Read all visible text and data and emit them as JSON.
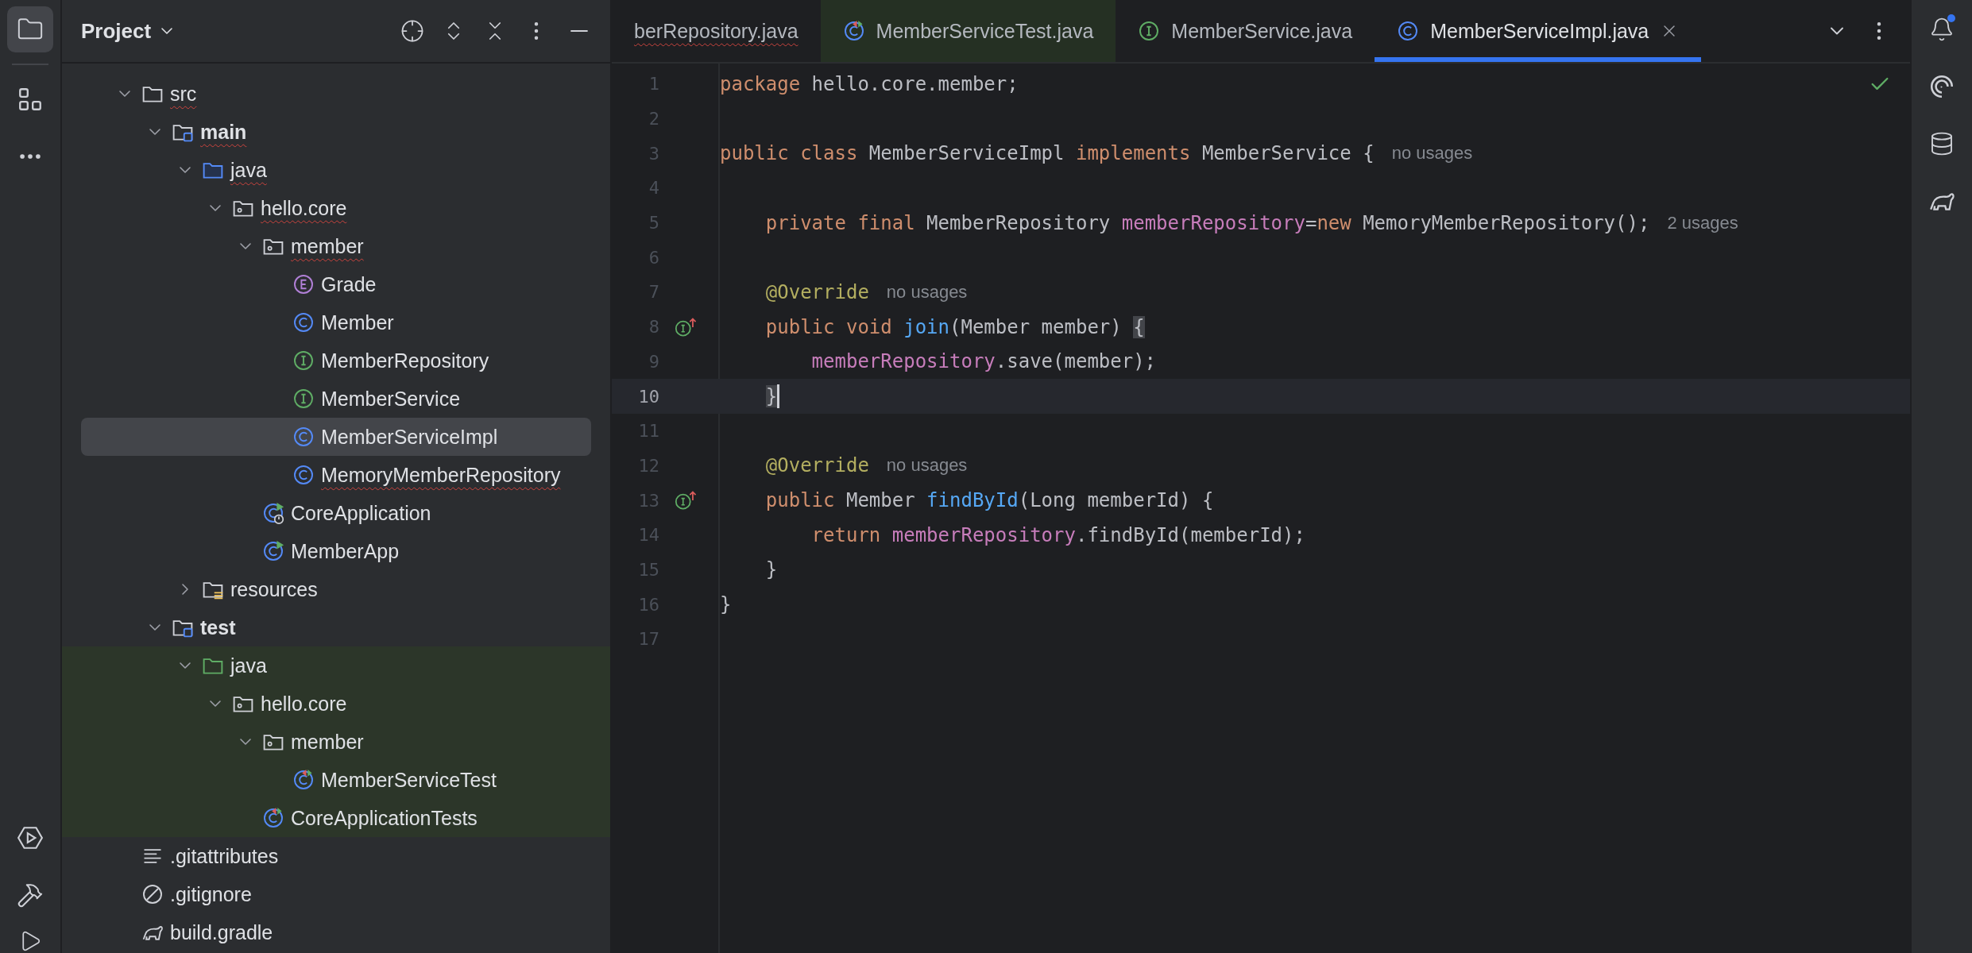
{
  "project_panel": {
    "title": "Project",
    "tree": [
      {
        "label": "src",
        "kind": "folder",
        "expanded": true,
        "selected": false,
        "error": true,
        "tinted": false,
        "children": [
          {
            "label": "main",
            "kind": "source-root",
            "expanded": true,
            "selected": false,
            "error": true,
            "tinted": false,
            "children": [
              {
                "label": "java",
                "kind": "source-folder",
                "expanded": true,
                "selected": false,
                "error": true,
                "tinted": false,
                "children": [
                  {
                    "label": "hello.core",
                    "kind": "package",
                    "expanded": true,
                    "selected": false,
                    "error": true,
                    "tinted": false,
                    "children": [
                      {
                        "label": "member",
                        "kind": "package",
                        "expanded": true,
                        "selected": false,
                        "error": true,
                        "tinted": false,
                        "children": [
                          {
                            "label": "Grade",
                            "kind": "enum",
                            "selected": false,
                            "error": false,
                            "tinted": false
                          },
                          {
                            "label": "Member",
                            "kind": "class",
                            "selected": false,
                            "error": false,
                            "tinted": false
                          },
                          {
                            "label": "MemberRepository",
                            "kind": "interface",
                            "selected": false,
                            "error": false,
                            "tinted": false
                          },
                          {
                            "label": "MemberService",
                            "kind": "interface",
                            "selected": false,
                            "error": false,
                            "tinted": false
                          },
                          {
                            "label": "MemberServiceImpl",
                            "kind": "class",
                            "selected": true,
                            "error": false,
                            "tinted": false
                          },
                          {
                            "label": "MemoryMemberRepository",
                            "kind": "class",
                            "selected": false,
                            "error": true,
                            "tinted": false
                          }
                        ]
                      },
                      {
                        "label": "CoreApplication",
                        "kind": "spring-app",
                        "selected": false,
                        "error": false,
                        "tinted": false
                      },
                      {
                        "label": "MemberApp",
                        "kind": "runnable",
                        "selected": false,
                        "error": false,
                        "tinted": false
                      }
                    ]
                  }
                ]
              },
              {
                "label": "resources",
                "kind": "resources",
                "expanded": false,
                "selected": false,
                "error": false,
                "tinted": false
              }
            ]
          },
          {
            "label": "test",
            "kind": "source-root",
            "expanded": true,
            "selected": false,
            "error": false,
            "tinted": false,
            "children": [
              {
                "label": "java",
                "kind": "test-folder",
                "expanded": true,
                "selected": false,
                "error": false,
                "tinted": true,
                "children": [
                  {
                    "label": "hello.core",
                    "kind": "package",
                    "expanded": true,
                    "selected": false,
                    "error": false,
                    "tinted": true,
                    "children": [
                      {
                        "label": "member",
                        "kind": "package",
                        "expanded": true,
                        "selected": false,
                        "error": false,
                        "tinted": true,
                        "children": [
                          {
                            "label": "MemberServiceTest",
                            "kind": "test-class",
                            "selected": false,
                            "error": false,
                            "tinted": true
                          }
                        ]
                      },
                      {
                        "label": "CoreApplicationTests",
                        "kind": "test-class",
                        "selected": false,
                        "error": false,
                        "tinted": true
                      }
                    ]
                  }
                ]
              }
            ]
          }
        ]
      },
      {
        "label": ".gitattributes",
        "kind": "text-file",
        "selected": false,
        "error": false,
        "tinted": false
      },
      {
        "label": ".gitignore",
        "kind": "ignore-file",
        "selected": false,
        "error": false,
        "tinted": false
      },
      {
        "label": "build.gradle",
        "kind": "gradle",
        "selected": false,
        "error": false,
        "tinted": false
      }
    ]
  },
  "editor": {
    "tabs": [
      {
        "label": "berRepository.java",
        "kind": "cut-off",
        "selected": false,
        "tinted": false,
        "error": true
      },
      {
        "label": "MemberServiceTest.java",
        "kind": "test-class",
        "selected": false,
        "tinted": true,
        "error": false
      },
      {
        "label": "MemberService.java",
        "kind": "interface",
        "selected": false,
        "tinted": false,
        "error": false
      },
      {
        "label": "MemberServiceImpl.java",
        "kind": "class",
        "selected": true,
        "tinted": false,
        "error": false
      }
    ],
    "lines": [
      {
        "number": "1",
        "current": false,
        "marker": false,
        "tokens": [
          {
            "kind": "keyword",
            "text": "package"
          },
          {
            "kind": "plain",
            "text": " hello.core.member;"
          }
        ]
      },
      {
        "number": "2",
        "current": false,
        "marker": false
      },
      {
        "number": "3",
        "current": false,
        "marker": false,
        "tokens": [
          {
            "kind": "keyword",
            "text": "public class "
          },
          {
            "kind": "plain",
            "text": "MemberServiceImpl "
          },
          {
            "kind": "keyword",
            "text": "implements "
          },
          {
            "kind": "plain",
            "text": "MemberService {"
          }
        ],
        "hint": "no usages"
      },
      {
        "number": "4",
        "current": false,
        "marker": false
      },
      {
        "number": "5",
        "current": false,
        "marker": false,
        "tokens": [
          {
            "kind": "keyword",
            "text": "    private final "
          },
          {
            "kind": "plain",
            "text": "MemberRepository "
          },
          {
            "kind": "field",
            "text": "memberRepository"
          },
          {
            "kind": "plain",
            "text": "="
          },
          {
            "kind": "keyword",
            "text": "new "
          },
          {
            "kind": "plain",
            "text": "MemoryMemberRepository();"
          }
        ],
        "hint": "2 usages"
      },
      {
        "number": "6",
        "current": false,
        "marker": false
      },
      {
        "number": "7",
        "current": false,
        "marker": false,
        "tokens": [
          {
            "kind": "annotation",
            "text": "    @Override"
          }
        ],
        "hint": "no usages"
      },
      {
        "number": "8",
        "current": false,
        "marker": true,
        "tokens": [
          {
            "kind": "keyword",
            "text": "    public void "
          },
          {
            "kind": "method",
            "text": "join"
          },
          {
            "kind": "plain",
            "text": "(Member member) "
          },
          {
            "kind": "brace-match",
            "text": "{"
          }
        ]
      },
      {
        "number": "9",
        "current": false,
        "marker": false,
        "tokens": [
          {
            "kind": "field",
            "text": "        memberRepository"
          },
          {
            "kind": "plain",
            "text": ".save(member);"
          }
        ]
      },
      {
        "number": "10",
        "current": true,
        "marker": false,
        "tokens": [
          {
            "kind": "brace-match",
            "text": "    }"
          }
        ]
      },
      {
        "number": "11",
        "current": false,
        "marker": false
      },
      {
        "number": "12",
        "current": false,
        "marker": false,
        "tokens": [
          {
            "kind": "annotation",
            "text": "    @Override"
          }
        ],
        "hint": "no usages"
      },
      {
        "number": "13",
        "current": false,
        "marker": true,
        "tokens": [
          {
            "kind": "keyword",
            "text": "    public "
          },
          {
            "kind": "plain",
            "text": "Member "
          },
          {
            "kind": "method",
            "text": "findById"
          },
          {
            "kind": "plain",
            "text": "(Long memberId) {"
          }
        ]
      },
      {
        "number": "14",
        "current": false,
        "marker": false,
        "tokens": [
          {
            "kind": "keyword",
            "text": "        return "
          },
          {
            "kind": "field",
            "text": "memberRepository"
          },
          {
            "kind": "plain",
            "text": ".findById(memberId);"
          }
        ]
      },
      {
        "number": "15",
        "current": false,
        "marker": false,
        "tokens": [
          {
            "kind": "plain",
            "text": "    }"
          }
        ]
      },
      {
        "number": "16",
        "current": false,
        "marker": false,
        "tokens": [
          {
            "kind": "plain",
            "text": "}"
          }
        ]
      },
      {
        "number": "17",
        "current": false,
        "marker": false
      }
    ]
  },
  "notifications": {
    "unread": true
  }
}
